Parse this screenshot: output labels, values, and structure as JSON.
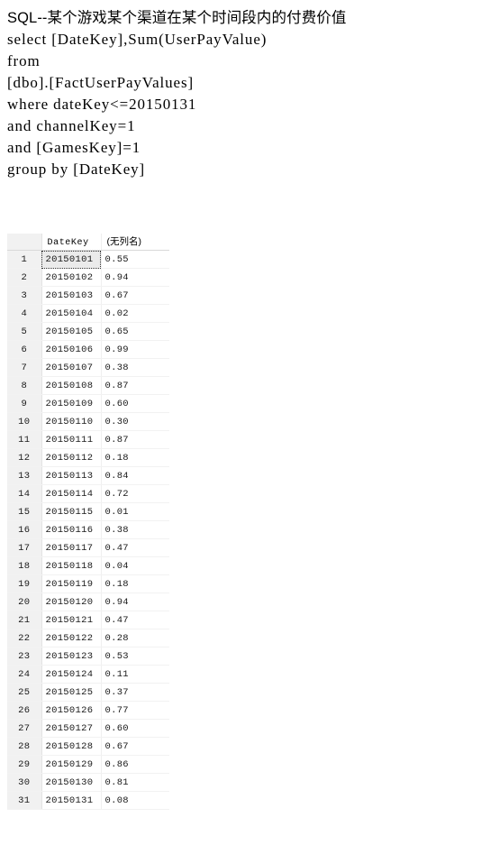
{
  "sql_block": {
    "title": "SQL--某个游戏某个渠道在某个时间段内的付费价值",
    "lines": [
      "select [DateKey],Sum(UserPayValue)",
      "from",
      "[dbo].[FactUserPayValues]",
      "where dateKey<=20150131",
      "and channelKey=1",
      "and [GamesKey]=1",
      "group by [DateKey]"
    ]
  },
  "result_grid": {
    "columns": [
      "",
      "DateKey",
      "(无列名)"
    ],
    "selected_cell": {
      "row": 1,
      "column": "DateKey"
    },
    "rows": [
      {
        "n": "1",
        "datekey": "20150101",
        "value": "0.55"
      },
      {
        "n": "2",
        "datekey": "20150102",
        "value": "0.94"
      },
      {
        "n": "3",
        "datekey": "20150103",
        "value": "0.67"
      },
      {
        "n": "4",
        "datekey": "20150104",
        "value": "0.02"
      },
      {
        "n": "5",
        "datekey": "20150105",
        "value": "0.65"
      },
      {
        "n": "6",
        "datekey": "20150106",
        "value": "0.99"
      },
      {
        "n": "7",
        "datekey": "20150107",
        "value": "0.38"
      },
      {
        "n": "8",
        "datekey": "20150108",
        "value": "0.87"
      },
      {
        "n": "9",
        "datekey": "20150109",
        "value": "0.60"
      },
      {
        "n": "10",
        "datekey": "20150110",
        "value": "0.30"
      },
      {
        "n": "11",
        "datekey": "20150111",
        "value": "0.87"
      },
      {
        "n": "12",
        "datekey": "20150112",
        "value": "0.18"
      },
      {
        "n": "13",
        "datekey": "20150113",
        "value": "0.84"
      },
      {
        "n": "14",
        "datekey": "20150114",
        "value": "0.72"
      },
      {
        "n": "15",
        "datekey": "20150115",
        "value": "0.01"
      },
      {
        "n": "16",
        "datekey": "20150116",
        "value": "0.38"
      },
      {
        "n": "17",
        "datekey": "20150117",
        "value": "0.47"
      },
      {
        "n": "18",
        "datekey": "20150118",
        "value": "0.04"
      },
      {
        "n": "19",
        "datekey": "20150119",
        "value": "0.18"
      },
      {
        "n": "20",
        "datekey": "20150120",
        "value": "0.94"
      },
      {
        "n": "21",
        "datekey": "20150121",
        "value": "0.47"
      },
      {
        "n": "22",
        "datekey": "20150122",
        "value": "0.28"
      },
      {
        "n": "23",
        "datekey": "20150123",
        "value": "0.53"
      },
      {
        "n": "24",
        "datekey": "20150124",
        "value": "0.11"
      },
      {
        "n": "25",
        "datekey": "20150125",
        "value": "0.37"
      },
      {
        "n": "26",
        "datekey": "20150126",
        "value": "0.77"
      },
      {
        "n": "27",
        "datekey": "20150127",
        "value": "0.60"
      },
      {
        "n": "28",
        "datekey": "20150128",
        "value": "0.67"
      },
      {
        "n": "29",
        "datekey": "20150129",
        "value": "0.86"
      },
      {
        "n": "30",
        "datekey": "20150130",
        "value": "0.81"
      },
      {
        "n": "31",
        "datekey": "20150131",
        "value": "0.08"
      }
    ]
  }
}
